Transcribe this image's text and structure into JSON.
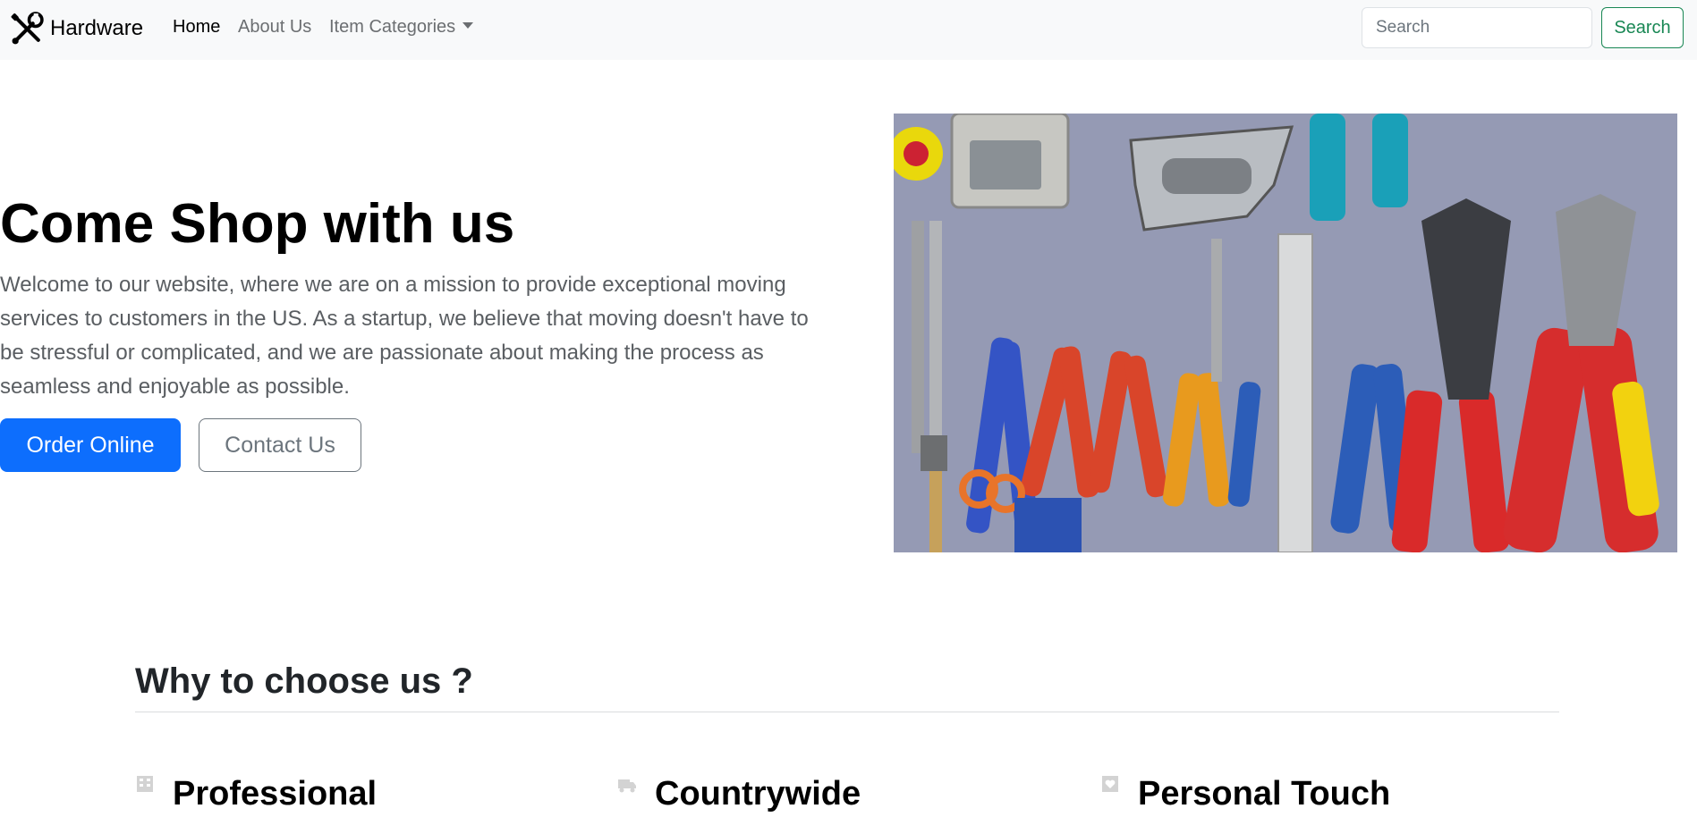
{
  "navbar": {
    "brand": "Hardware",
    "links": [
      "Home",
      "About Us",
      "Item Categories"
    ],
    "search": {
      "placeholder": "Search",
      "button": "Search"
    }
  },
  "hero": {
    "title": "Come Shop with us",
    "lead": "Welcome to our website, where we are on a mission to provide exceptional moving services to customers in the US. As a startup, we believe that moving doesn't have to be stressful or complicated, and we are passionate about making the process as seamless and enjoyable as possible.",
    "primary_button": "Order Online",
    "secondary_button": "Contact Us"
  },
  "why": {
    "title": "Why to choose us ?",
    "features": [
      {
        "icon": "building-icon",
        "title": "Professional"
      },
      {
        "icon": "truck-icon",
        "title": "Countrywide"
      },
      {
        "icon": "heart-icon",
        "title": "Personal Touch"
      }
    ]
  },
  "colors": {
    "primary": "#0d6efd",
    "success": "#198754",
    "navbar_bg": "#f8f9fa"
  }
}
